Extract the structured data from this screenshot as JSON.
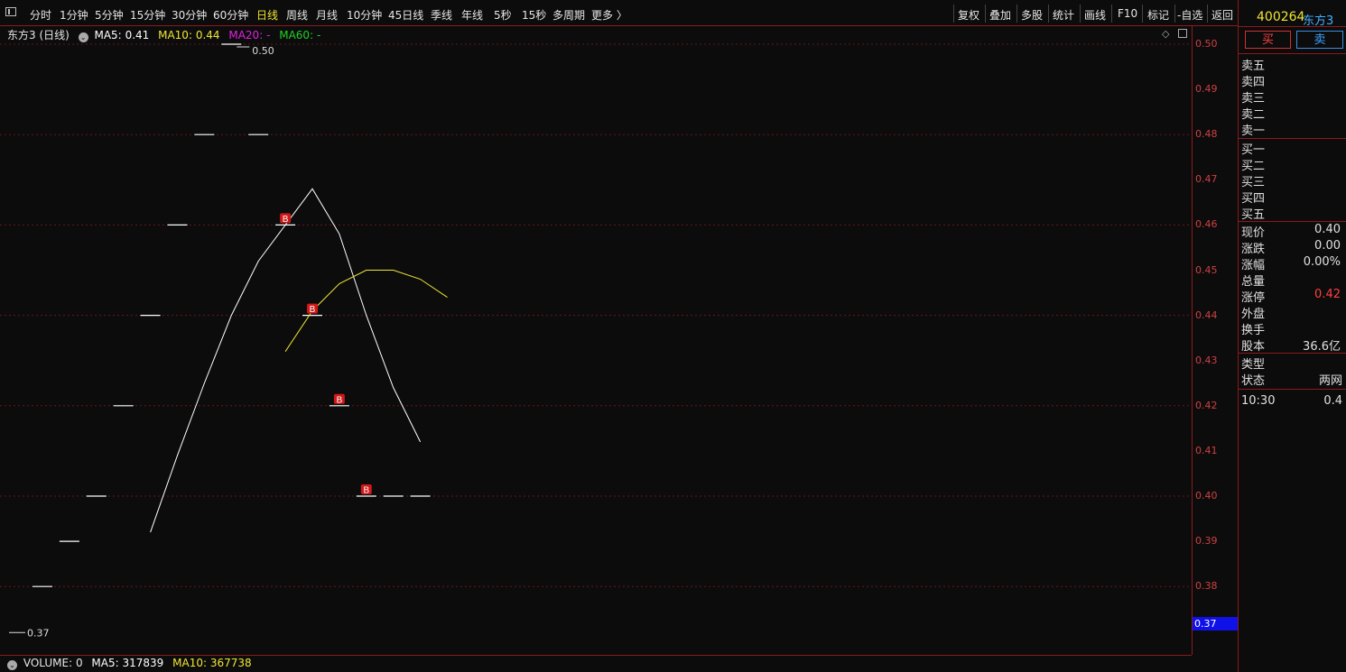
{
  "toolbar": {
    "tabs": [
      "分时",
      "1分钟",
      "5分钟",
      "15分钟",
      "30分钟",
      "60分钟",
      "日线",
      "周线",
      "月线",
      "10分钟",
      "45日线",
      "季线",
      "年线",
      "5秒",
      "15秒",
      "多周期",
      "更多 〉"
    ],
    "active_tab": "日线",
    "right_tools": [
      "复权",
      "叠加",
      "多股",
      "统计",
      "画线",
      "F10",
      "标记",
      "-自选",
      "返回"
    ]
  },
  "chart": {
    "title": "东方3 (日线)",
    "ma5_label": "MA5:",
    "ma5_value": "0.41",
    "ma10_label": "MA10:",
    "ma10_value": "0.44",
    "ma20_label": "MA20:",
    "ma20_value": "-",
    "ma60_label": "MA60:",
    "ma60_value": "-",
    "high_marker": "0.50",
    "low_marker": "0.37",
    "price_ticks": [
      "0.50",
      "0.49",
      "0.48",
      "0.47",
      "0.46",
      "0.45",
      "0.44",
      "0.43",
      "0.42",
      "0.41",
      "0.40",
      "0.39",
      "0.38"
    ],
    "last_price_tag": "0.37",
    "buy_marker_label": "B",
    "colors": {
      "ma5": "#ffffff",
      "ma10": "#f0e632",
      "ma20": "#e020e0",
      "ma60": "#20d020",
      "axis": "#d04040",
      "grid": "#6a1515",
      "candle": "#ffffff",
      "marker": "#d01818"
    },
    "volume_header": {
      "volume_label": "VOLUME:",
      "volume_value": "0",
      "ma5_label": "MA5:",
      "ma5_value": "317839",
      "ma10_label": "MA10:",
      "ma10_value": "367738"
    }
  },
  "chart_data": {
    "type": "line",
    "title": "东方3 (日线)",
    "ylim": [
      0.37,
      0.5
    ],
    "candles_close": [
      0.38,
      0.39,
      0.4,
      0.42,
      0.44,
      0.46,
      0.48,
      0.5,
      0.48,
      0.46,
      0.44,
      0.42,
      0.4,
      0.4,
      0.4
    ],
    "buy_signals_at": [
      9,
      10,
      11,
      12
    ],
    "series": [
      {
        "name": "MA5",
        "values": [
          null,
          null,
          null,
          null,
          0.392,
          0.409,
          0.425,
          0.44,
          0.452,
          0.46,
          0.468,
          0.458,
          0.44,
          0.424,
          0.412
        ]
      },
      {
        "name": "MA10",
        "values": [
          null,
          null,
          null,
          null,
          null,
          null,
          null,
          null,
          null,
          0.432,
          0.441,
          0.447,
          0.45,
          0.45,
          0.448,
          0.444
        ]
      }
    ]
  },
  "side": {
    "code": "400264",
    "name": "东方3",
    "buy_button": "买",
    "sell_button": "卖",
    "sell_levels": [
      "卖五",
      "卖四",
      "卖三",
      "卖二",
      "卖一"
    ],
    "buy_levels": [
      "买一",
      "买二",
      "买三",
      "买四",
      "买五"
    ],
    "quote_labels": [
      "现价",
      "涨跌",
      "涨幅",
      "总量",
      "涨停",
      "外盘",
      "换手",
      "股本"
    ],
    "quote_values": [
      "0.40",
      "0.00",
      "0.00%",
      "",
      "0.42",
      "",
      "",
      "36.6亿"
    ],
    "type_label": "类型",
    "status_label": "状态",
    "status_value": "两网",
    "tick_time": "10:30",
    "tick_price": "0.4"
  }
}
